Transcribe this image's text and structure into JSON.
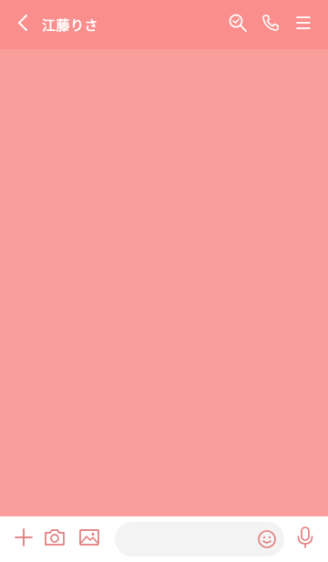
{
  "header": {
    "title": "江藤りさ",
    "icons": [
      "back-icon",
      "search-icon",
      "phone-icon",
      "menu-icon"
    ]
  },
  "footer": {
    "icons": [
      "plus-icon",
      "camera-icon",
      "image-icon",
      "emoji-icon",
      "mic-icon"
    ],
    "input_placeholder": ""
  },
  "colors": {
    "header_bg": "#f98e8c",
    "chat_bg": "#fa9e9b",
    "footer_bg": "#ffffff",
    "icon_color": "#ffffff",
    "footer_icon_color": "#e27a7a"
  }
}
